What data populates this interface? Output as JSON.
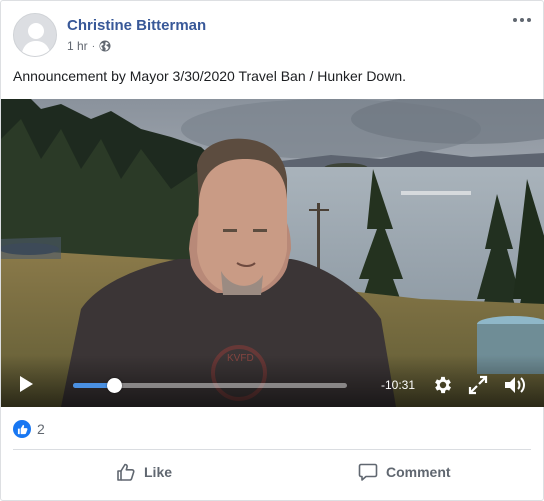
{
  "post": {
    "author": "Christine Bitterman",
    "time": "1 hr",
    "separator": "·",
    "audience_icon": "globe-icon",
    "text": "Announcement by Mayor 3/30/2020 Travel Ban / Hunker Down."
  },
  "video": {
    "remaining_time": "-10:31",
    "progress": 0.15,
    "controls": [
      "play-icon",
      "gear-icon",
      "expand-icon",
      "volume-icon"
    ]
  },
  "reactions": {
    "icon": "thumbs-up-icon",
    "count": "2"
  },
  "actions": {
    "like_label": "Like",
    "comment_label": "Comment"
  },
  "colors": {
    "author": "#385898",
    "like_badge": "#1877f2",
    "progress": "#4a90e2"
  }
}
